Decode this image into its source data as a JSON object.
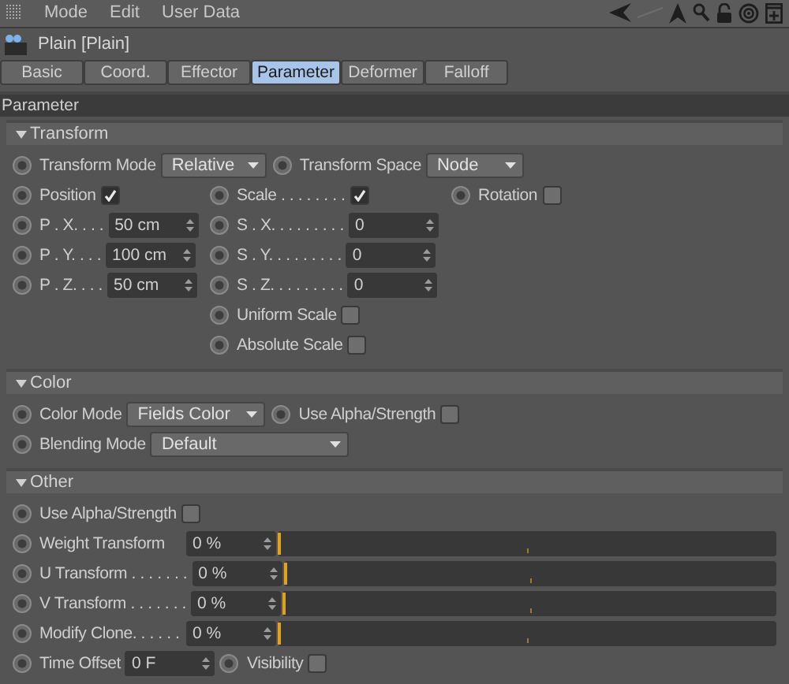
{
  "menu": [
    "Mode",
    "Edit",
    "User Data"
  ],
  "object_title": "Plain [Plain]",
  "tabs": [
    {
      "label": "Basic",
      "selected": false
    },
    {
      "label": "Coord.",
      "selected": false
    },
    {
      "label": "Effector",
      "selected": false
    },
    {
      "label": "Parameter",
      "selected": true
    },
    {
      "label": "Deformer",
      "selected": false
    },
    {
      "label": "Falloff",
      "selected": false
    }
  ],
  "panel_title": "Parameter",
  "transform": {
    "title": "Transform",
    "expanded": true,
    "mode": {
      "label": "Transform Mode",
      "value": "Relative"
    },
    "space": {
      "label": "Transform Space",
      "value": "Node"
    },
    "toggles": [
      {
        "label": "Position",
        "checked": true
      },
      {
        "label": "Scale . . . . . . . .",
        "checked": true
      },
      {
        "label": "Rotation",
        "checked": false
      }
    ],
    "position_fields": [
      {
        "label": "P . X. . . .",
        "value": "50 cm"
      },
      {
        "label": "P . Y. . . .",
        "value": "100 cm"
      },
      {
        "label": "P . Z. . . .",
        "value": "50 cm"
      }
    ],
    "scale_fields": [
      {
        "label": "S . X. . . . . . . . .",
        "value": "0"
      },
      {
        "label": "S . Y. . . . . . . . .",
        "value": "0"
      },
      {
        "label": "S . Z. . . . . . . . .",
        "value": "0"
      }
    ],
    "scale_options": [
      {
        "label": "Uniform Scale",
        "checked": false
      },
      {
        "label": "Absolute Scale",
        "checked": false
      }
    ]
  },
  "color": {
    "title": "Color",
    "expanded": true,
    "mode": {
      "label": "Color Mode",
      "value": "Fields Color"
    },
    "use_alpha": {
      "label": "Use Alpha/Strength",
      "checked": false
    },
    "blending": {
      "label": "Blending Mode",
      "value": "Default"
    }
  },
  "other": {
    "title": "Other",
    "expanded": true,
    "use_alpha": {
      "label": "Use Alpha/Strength",
      "checked": false
    },
    "sliders": [
      {
        "label": "Weight Transform",
        "value": "0 %",
        "level": 0
      },
      {
        "label": "U Transform . . . . . . .",
        "value": "0 %",
        "level": 0
      },
      {
        "label": "V Transform . . . . . . .",
        "value": "0 %",
        "level": 0
      },
      {
        "label": "Modify Clone. . . . . .",
        "value": "0 %",
        "level": 0
      }
    ],
    "time_offset": {
      "label": "Time Offset",
      "value": "0 F"
    },
    "visibility": {
      "label": "Visibility",
      "checked": false
    }
  }
}
